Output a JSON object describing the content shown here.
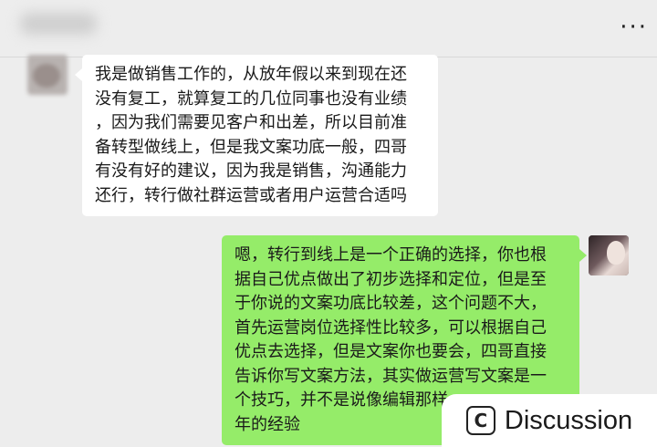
{
  "header": {
    "more_icon": "more-dots-icon",
    "more_text": "···"
  },
  "messages": {
    "incoming": {
      "lines": [
        "我是做销售工作的，从放年假以来到现在还",
        "没有复工，就算复工的几位同事也没有业绩",
        "，因为我们需要见客户和出差，所以目前准",
        "备转型做线上，但是我文案功底一般，四哥",
        "有没有好的建议，因为我是销售，沟通能力",
        "还行，转行做社群运营或者用户运营合适吗"
      ]
    },
    "outgoing": {
      "lines": [
        "嗯，转行到线上是一个正确的选择，你也根",
        "据自己优点做出了初步选择和定位，但是至",
        "于你说的文案功底比较差，这个问题不大，",
        "首先运营岗位选择性比较多，可以根据自己",
        "优点去选择，但是文案你也要会，四哥直接",
        "告诉你写文案方法，其实做运营写文案是一",
        "个技巧，并不是说像编辑那样",
        "年的经验"
      ]
    }
  },
  "watermark": {
    "icon_letter": "C",
    "text": "Discussion"
  },
  "colors": {
    "background": "#ededed",
    "incoming_bubble": "#ffffff",
    "outgoing_bubble": "#95ec69"
  }
}
